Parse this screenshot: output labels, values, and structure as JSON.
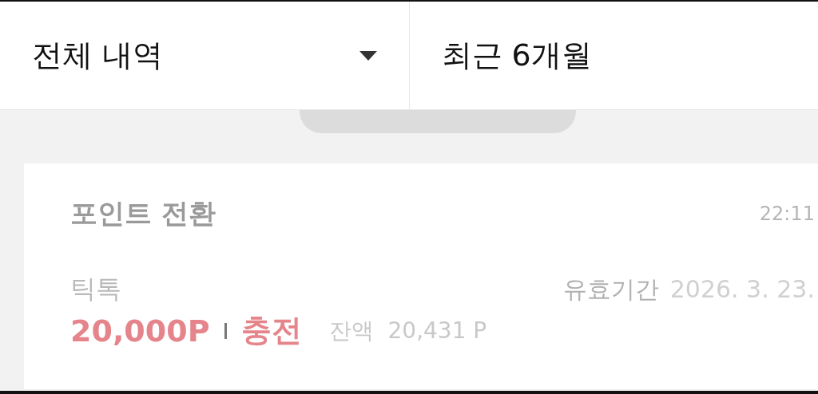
{
  "filters": {
    "type_dropdown": {
      "value": "전체 내역"
    },
    "period": {
      "value": "최근 6개월"
    }
  },
  "transaction": {
    "title": "포인트 전환",
    "time": "22:11",
    "source": "틱톡",
    "expiry_label": "유효기간",
    "expiry_date": "2026. 3. 23.",
    "amount": "20,000P",
    "type": "충전",
    "balance_label": "잔액",
    "balance": "20,431 P"
  }
}
